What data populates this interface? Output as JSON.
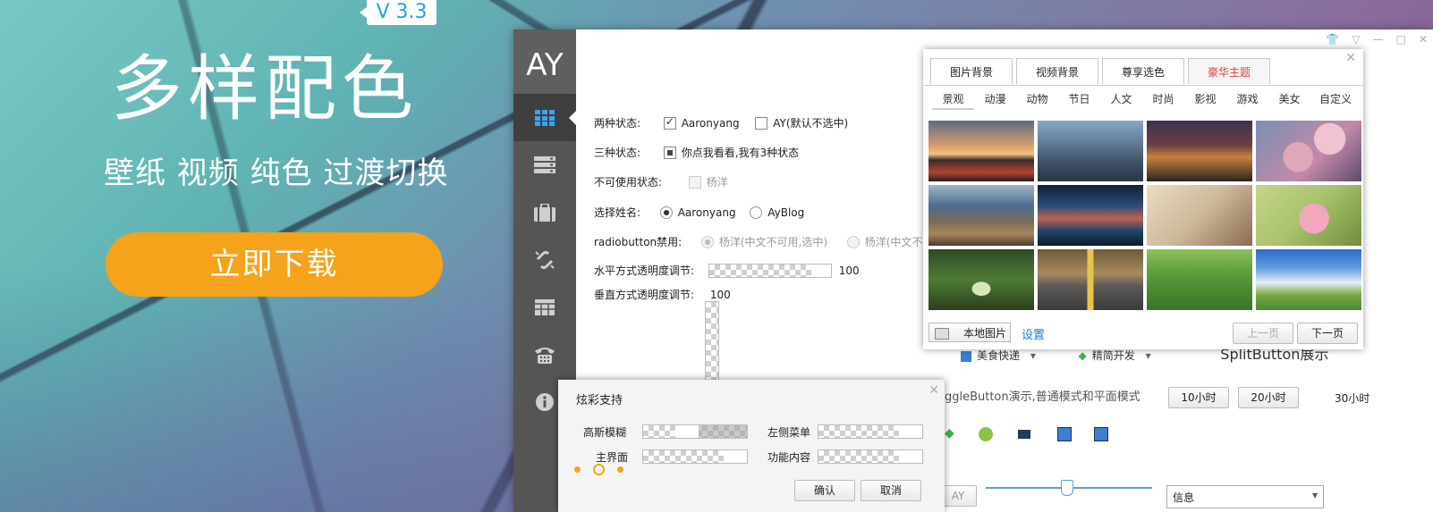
{
  "hero": {
    "version": "V 3.3",
    "headline": "多样配色",
    "subline": "壁纸 视频 纯色 过渡切换",
    "download_label": "立即下载"
  },
  "window": {
    "logo": "AY",
    "sidebar_icons": [
      "grid-icon",
      "list-icon",
      "briefcase-icon",
      "link-icon",
      "table-icon",
      "phone-icon",
      "info-icon"
    ],
    "controls": {
      "two_state_label": "两种状态:",
      "two_state_opt1": "Aaronyang",
      "two_state_opt2": "AY(默认不选中)",
      "three_state_label": "三种状态:",
      "three_state_text": "你点我看看,我有3种状态",
      "disabled_label": "不可使用状态:",
      "disabled_text": "杨洋",
      "choose_label": "选择姓名:",
      "choose_opt1": "Aaronyang",
      "choose_opt2": "AyBlog",
      "radio_disabled_label": "radiobutton禁用:",
      "radio_disabled_opt1": "杨洋(中文不可用,选中)",
      "radio_disabled_opt2": "杨洋(中文不可用",
      "h_opacity_label": "水平方式透明度调节:",
      "h_opacity_value": "100",
      "v_opacity_label": "垂直方式透明度调节:",
      "v_opacity_value": "100"
    },
    "peek": {
      "item1": "美食快递",
      "item2": "精简开发",
      "item3": "SplitButton展示",
      "toggle_text": "oggleButton演示,普通模式和平面模式",
      "btn1": "10小时",
      "btn2": "20小时",
      "btn3": "30小时",
      "bottom_left": "AY",
      "select_value": "信息"
    }
  },
  "bg_popup": {
    "tabs": [
      "图片背景",
      "视频背景",
      "尊享选色",
      "豪华主题"
    ],
    "categories": [
      "景观",
      "动漫",
      "动物",
      "节日",
      "人文",
      "时尚",
      "影视",
      "游戏",
      "美女",
      "自定义"
    ],
    "local_button": "本地图片",
    "settings_link": "设置",
    "prev_button": "上一页",
    "next_button": "下一页"
  },
  "effects_dialog": {
    "title": "炫彩支持",
    "gaussian_label": "高斯模糊",
    "main_label": "主界面",
    "left_menu_label": "左侧菜单",
    "content_label": "功能内容",
    "ok_button": "确认",
    "cancel_button": "取消"
  },
  "colors": {
    "accent_orange": "#f4a31a",
    "link_blue": "#1a7fd1",
    "sidebar_dark": "#555555",
    "lux_red": "#e23b3b"
  }
}
